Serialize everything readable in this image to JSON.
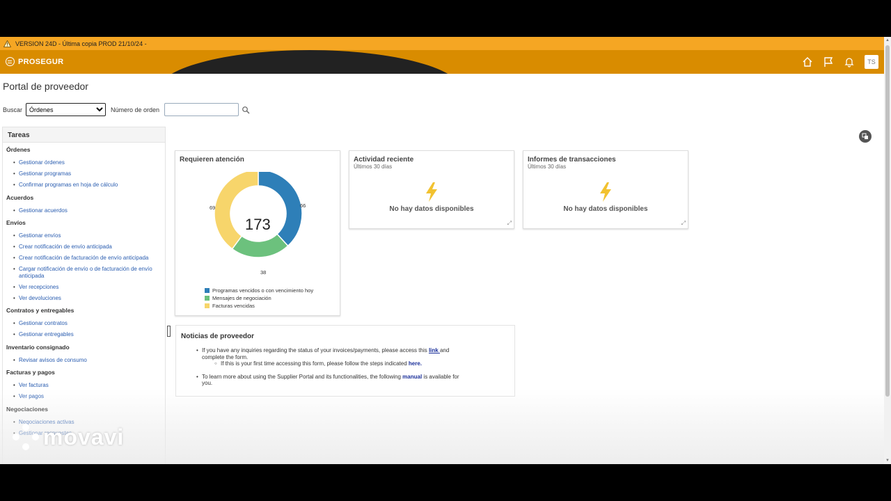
{
  "version_bar": {
    "text": "VERSION 24D - Última copia PROD 21/10/24 -"
  },
  "header": {
    "brand": "PROSEGUR",
    "avatar": "TS",
    "icons": [
      "home-icon",
      "flag-icon",
      "bell-icon"
    ]
  },
  "page": {
    "title": "Portal de proveedor"
  },
  "search": {
    "label": "Buscar",
    "selected": "Órdenes",
    "order_label": "Número de orden",
    "order_value": ""
  },
  "tasks": {
    "title": "Tareas",
    "groups": [
      {
        "name": "Órdenes",
        "items": [
          "Gestionar órdenes",
          "Gestionar programas",
          "Confirmar programas en hoja de cálculo"
        ]
      },
      {
        "name": "Acuerdos",
        "items": [
          "Gestionar acuerdos"
        ]
      },
      {
        "name": "Envíos",
        "items": [
          "Gestionar envíos",
          "Crear notificación de envío anticipada",
          "Crear notificación de facturación de envío anticipada",
          "Cargar notificación de envío o de facturación de envío anticipada",
          "Ver recepciones",
          "Ver devoluciones"
        ]
      },
      {
        "name": "Contratos y entregables",
        "items": [
          "Gestionar contratos",
          "Gestionar entregables"
        ]
      },
      {
        "name": "Inventario consignado",
        "items": [
          "Revisar avisos de consumo"
        ]
      },
      {
        "name": "Facturas y pagos",
        "items": [
          "Ver facturas",
          "Ver pagos"
        ]
      },
      {
        "name": "Negociaciones",
        "items": [
          "Negociaciones activas",
          "Gestionar respuestas"
        ]
      }
    ]
  },
  "attention_card": {
    "title": "Requieren atención",
    "total": "173",
    "segments": [
      {
        "label": "Programas vencidos o con vencimiento hoy",
        "value": 66,
        "color": "#2e7fb8"
      },
      {
        "label": "Mensajes de negociación",
        "value": 38,
        "color": "#6cc17d"
      },
      {
        "label": "Facturas vencidas",
        "value": 69,
        "color": "#f7d56b"
      }
    ]
  },
  "activity_card": {
    "title": "Actividad reciente",
    "subtitle": "Últimos 30 días",
    "empty": "No hay datos disponibles"
  },
  "reports_card": {
    "title": "Informes de transacciones",
    "subtitle": "Últimos 30 días",
    "empty": "No hay datos disponibles"
  },
  "news": {
    "title": "Noticias de proveedor",
    "item1_pre": "If you have any inquiries regarding the status of your invoices/payments, please access this ",
    "item1_link": "link ",
    "item1_post": "and complete the form.",
    "sub_pre": "If this is your first time accessing this form, please follow the steps indicated ",
    "sub_link": "here.",
    "item2_pre": "To learn more about using the Supplier Portal and its functionalities, the following ",
    "item2_link": "manual",
    "item2_post": " is available for you."
  },
  "watermark": {
    "text": "movavi"
  }
}
